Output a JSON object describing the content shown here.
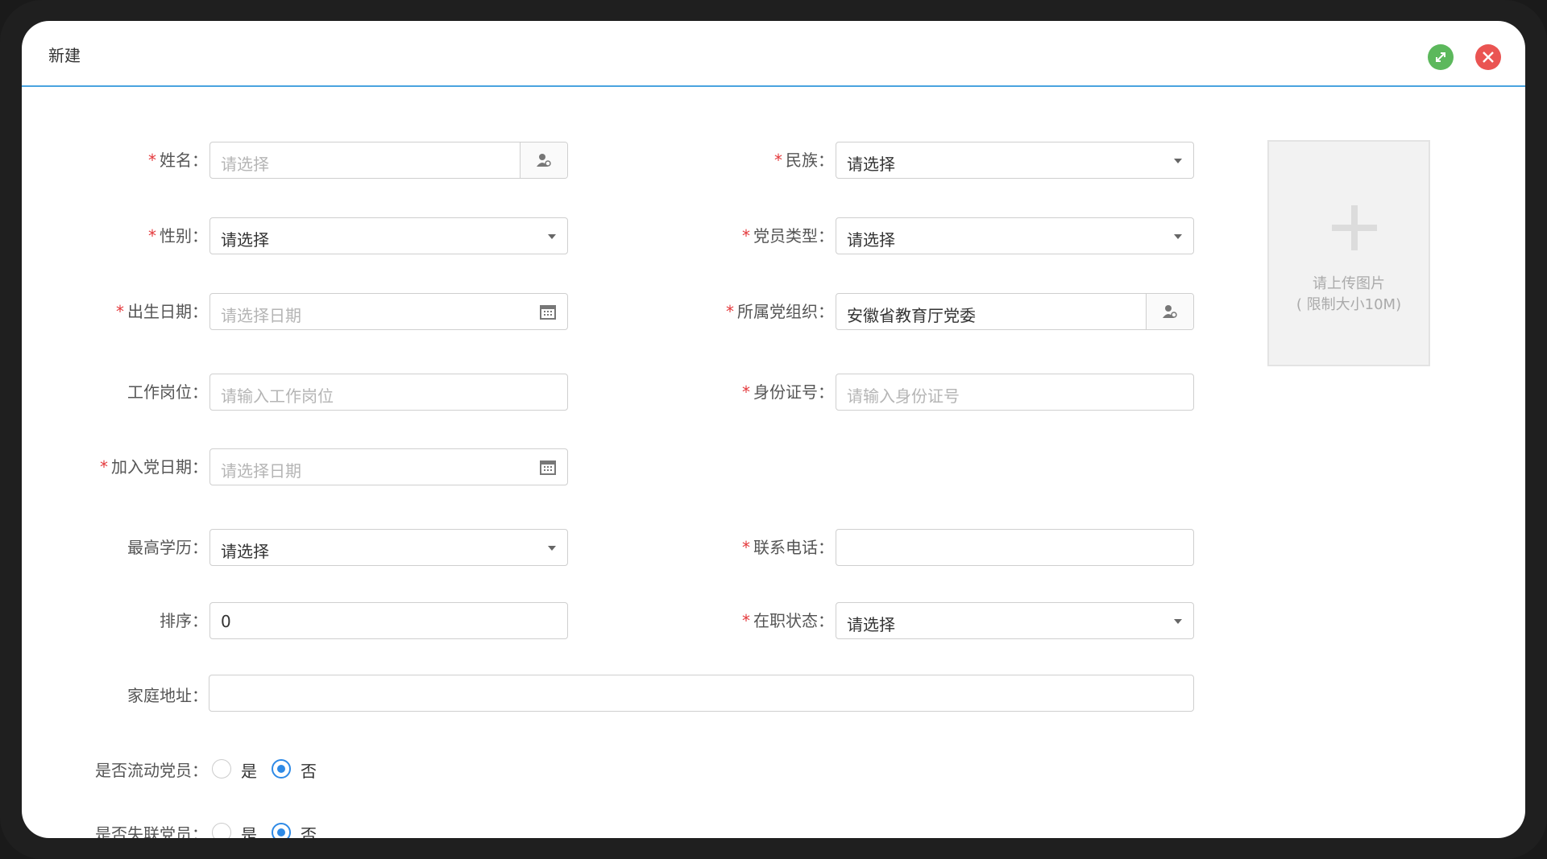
{
  "dialog": {
    "title": "新建"
  },
  "form": {
    "name": {
      "label": "姓名：",
      "placeholder": "请选择"
    },
    "ethnicity": {
      "label": "民族：",
      "value": "请选择"
    },
    "gender": {
      "label": "性别：",
      "value": "请选择"
    },
    "member_type": {
      "label": "党员类型：",
      "value": "请选择"
    },
    "birth_date": {
      "label": "出生日期：",
      "placeholder": "请选择日期"
    },
    "org": {
      "label": "所属党组织：",
      "value": "安徽省教育厅党委"
    },
    "job": {
      "label": "工作岗位：",
      "placeholder": "请输入工作岗位"
    },
    "id_number": {
      "label": "身份证号：",
      "placeholder": "请输入身份证号"
    },
    "join_date": {
      "label": "加入党日期：",
      "placeholder": "请选择日期"
    },
    "education": {
      "label": "最高学历：",
      "value": "请选择"
    },
    "phone": {
      "label": "联系电话：",
      "value": ""
    },
    "sort": {
      "label": "排序：",
      "value": "0"
    },
    "employment": {
      "label": "在职状态：",
      "value": "请选择"
    },
    "address": {
      "label": "家庭地址：",
      "value": ""
    },
    "floating": {
      "label": "是否流动党员：",
      "yes": "是",
      "no": "否",
      "selected": "否"
    },
    "lost_contact": {
      "label": "是否失联党员：",
      "yes": "是",
      "no": "否",
      "selected": "否"
    }
  },
  "upload": {
    "line1": "请上传图片",
    "line2": "( 限制大小10M)"
  },
  "required_mark": "*",
  "colors": {
    "accent": "#2e8ae6",
    "required": "#e4393c",
    "header_line": "#4aa3df",
    "maximize": "#5cb85c",
    "close": "#ea5452"
  },
  "icons": [
    "maximize-icon",
    "close-icon",
    "user-picker-icon",
    "calendar-icon",
    "chevron-down-icon",
    "plus-icon"
  ]
}
